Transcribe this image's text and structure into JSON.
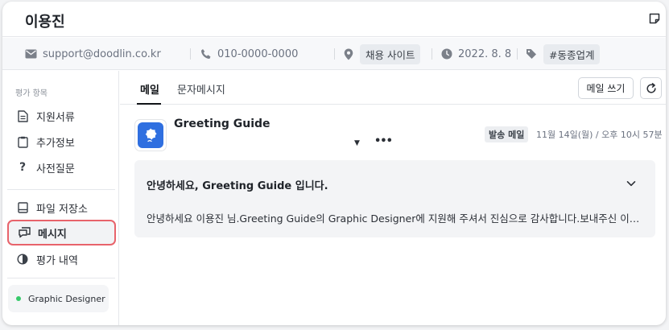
{
  "header": {
    "title": "이용진"
  },
  "contact": {
    "email": "support@doodlin.co.kr",
    "phone": "010-0000-0000",
    "source_chip": "채용 사이트",
    "date": "2022. 8. 8",
    "tag_chip": "#동종업계"
  },
  "sidebar": {
    "section_label": "평가 항목",
    "items": [
      {
        "label": "지원서류",
        "icon": "document-icon"
      },
      {
        "label": "추가정보",
        "icon": "clipboard-icon"
      },
      {
        "label": "사전질문",
        "icon": "question-icon"
      },
      {
        "label": "파일 저장소",
        "icon": "storage-icon"
      },
      {
        "label": "메시지",
        "icon": "message-icon",
        "active": true
      },
      {
        "label": "평가 내역",
        "icon": "half-circle-icon"
      }
    ],
    "role": "Graphic Designer"
  },
  "main": {
    "tabs": [
      {
        "label": "메일",
        "active": true
      },
      {
        "label": "문자메시지"
      }
    ],
    "write_label": "메일 쓰기",
    "message": {
      "sender": "Greeting Guide",
      "badge": "발송 메일",
      "timestamp": "11월 14일(월) / 오후 10시 57분",
      "subject": "안녕하세요, Greeting Guide 입니다.",
      "preview": "안녕하세요 이용진 님.Greeting Guide의 Graphic Designer에 지원해 주셔서 진심으로 감사합니다.보내주신 이력서와 포트폴리오를 바탕으로 면밀히 검토하였습니다."
    }
  },
  "colors": {
    "accent_highlight": "#e8636b",
    "status_dot": "#36c96a",
    "avatar_blue": "#2f6fe0"
  }
}
